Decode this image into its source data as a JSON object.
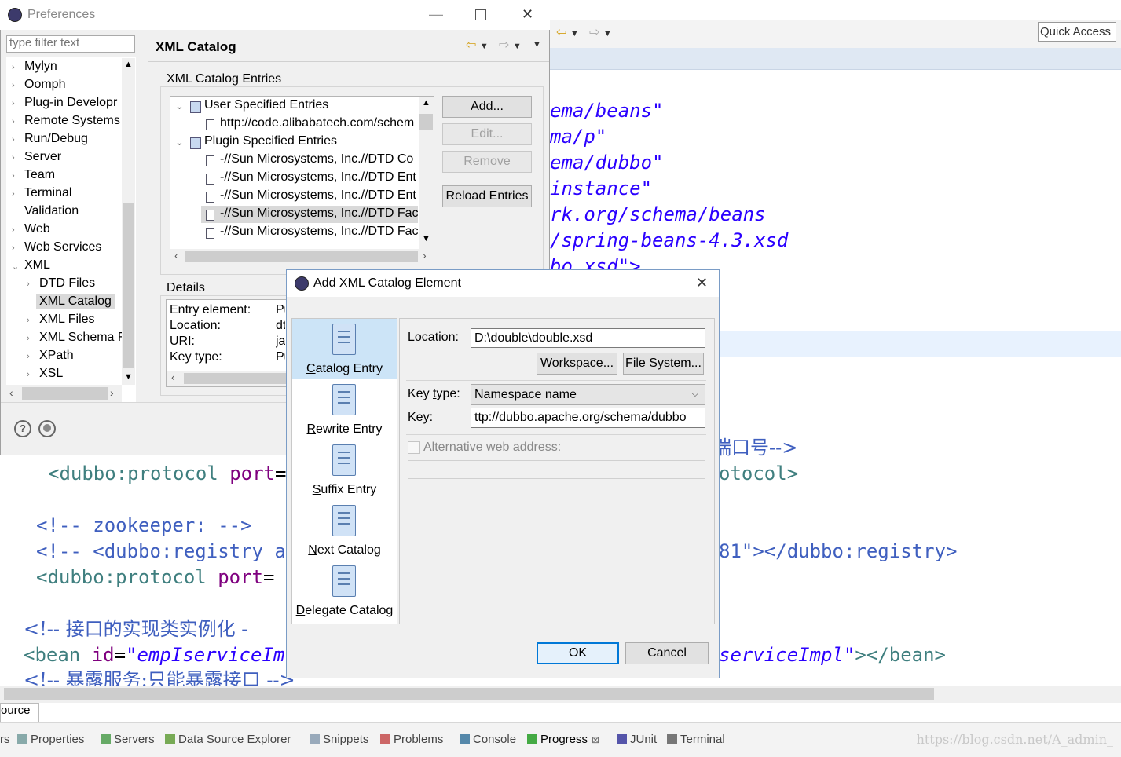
{
  "editor": {
    "quick_access": "Quick Access",
    "lines": [
      {
        "parts": [
          {
            "t": "ema/beans\"",
            "c": "str"
          }
        ]
      },
      {
        "parts": [
          {
            "t": "ma/p\"",
            "c": "str"
          }
        ]
      },
      {
        "parts": [
          {
            "t": "ema/dubbo\"",
            "c": "str"
          }
        ]
      },
      {
        "parts": [
          {
            "t": "instance\"",
            "c": "str"
          }
        ]
      },
      {
        "parts": [
          {
            "t": "rk.org/schema/beans",
            "c": "str"
          }
        ]
      },
      {
        "parts": [
          {
            "t": "/spring-beans-4.3.xsd",
            "c": "str"
          }
        ]
      },
      {
        "parts": [
          {
            "t": "bo.xsd\">",
            "c": "str"
          }
        ]
      }
    ],
    "port_comment_tail": "端口号-->",
    "protocol1_left": "<dubbo:protocol port=",
    "protocol1_right": "otocol>",
    "zk_comment": "<!-- zookeeper: -->",
    "registry_left": "<!-- <dubbo:registry a",
    "registry_right": "81\"></dubbo:registry>",
    "protocol2_left": "<dubbo:protocol port=",
    "impl_comment": "<!-- 接口的实现类实例化 -",
    "bean_left_tag": "<bean ",
    "bean_left_attr": "id",
    "bean_left_eq": "=",
    "bean_left_val": "\"empIserviceIm",
    "bean_right_val": "serviceImpl\"",
    "bean_right_tag": "></bean>",
    "expose_comment": "<!-- 暴露服务:只能暴露接口 -->"
  },
  "bottom": {
    "source_tab": "ource",
    "tabs": [
      {
        "label": "rs",
        "icon": "none"
      },
      {
        "label": "Properties",
        "icon": "properties-icon"
      },
      {
        "label": "Servers",
        "icon": "servers-icon"
      },
      {
        "label": "Data Source Explorer",
        "icon": "datasource-icon"
      },
      {
        "label": "Snippets",
        "icon": "snippets-icon"
      },
      {
        "label": "Problems",
        "icon": "problems-icon"
      },
      {
        "label": "Console",
        "icon": "console-icon"
      },
      {
        "label": "Progress",
        "icon": "progress-icon"
      },
      {
        "label": "JUnit",
        "icon": "junit-icon"
      },
      {
        "label": "Terminal",
        "icon": "terminal-icon"
      }
    ],
    "watermark": "https://blog.csdn.net/A_admin_"
  },
  "preferences": {
    "title": "Preferences",
    "filter_placeholder": "type filter text",
    "tree": [
      {
        "label": "Mylyn",
        "expander": "›",
        "level": 0
      },
      {
        "label": "Oomph",
        "expander": "›",
        "level": 0
      },
      {
        "label": "Plug-in Developr",
        "expander": "›",
        "level": 0
      },
      {
        "label": "Remote Systems",
        "expander": "›",
        "level": 0
      },
      {
        "label": "Run/Debug",
        "expander": "›",
        "level": 0
      },
      {
        "label": "Server",
        "expander": "›",
        "level": 0
      },
      {
        "label": "Team",
        "expander": "›",
        "level": 0
      },
      {
        "label": "Terminal",
        "expander": "›",
        "level": 0
      },
      {
        "label": "Validation",
        "expander": "",
        "level": 0
      },
      {
        "label": "Web",
        "expander": "›",
        "level": 0
      },
      {
        "label": "Web Services",
        "expander": "›",
        "level": 0
      },
      {
        "label": "XML",
        "expander": "⌄",
        "level": 0
      },
      {
        "label": "DTD Files",
        "expander": "›",
        "level": 1
      },
      {
        "label": "XML Catalog",
        "expander": "",
        "level": 1,
        "selected": true
      },
      {
        "label": "XML Files",
        "expander": "›",
        "level": 1
      },
      {
        "label": "XML Schema F",
        "expander": "›",
        "level": 1
      },
      {
        "label": "XPath",
        "expander": "›",
        "level": 1
      },
      {
        "label": "XSL",
        "expander": "›",
        "level": 1
      }
    ],
    "page_title": "XML Catalog",
    "entries_group": "XML Catalog Entries",
    "entries": [
      {
        "label": "User Specified Entries",
        "kind": "catalog",
        "level": 0,
        "expander": "⌄"
      },
      {
        "label": "http://code.alibabatech.com/schem",
        "kind": "doc",
        "level": 1
      },
      {
        "label": "Plugin Specified Entries",
        "kind": "catalog",
        "level": 0,
        "expander": "⌄"
      },
      {
        "label": "-//Sun Microsystems, Inc.//DTD Co",
        "kind": "doc",
        "level": 1
      },
      {
        "label": "-//Sun Microsystems, Inc.//DTD Ent",
        "kind": "doc",
        "level": 1
      },
      {
        "label": "-//Sun Microsystems, Inc.//DTD Ent",
        "kind": "doc",
        "level": 1
      },
      {
        "label": "-//Sun Microsystems, Inc.//DTD Fac",
        "kind": "doc",
        "level": 1,
        "selected": true
      },
      {
        "label": "-//Sun Microsystems, Inc.//DTD Fac",
        "kind": "doc",
        "level": 1
      }
    ],
    "buttons": {
      "add": "Add...",
      "edit": "Edit...",
      "remove": "Remove",
      "reload": "Reload Entries"
    },
    "details_group": "Details",
    "details": [
      {
        "key": "Entry element:",
        "val": "Pu"
      },
      {
        "key": "Location:",
        "val": "dt"
      },
      {
        "key": "URI:",
        "val": "ja"
      },
      {
        "key": "Key type:",
        "val": "Pu"
      }
    ]
  },
  "dialog": {
    "title": "Add XML Catalog Element",
    "entry_types": [
      {
        "label": "Catalog Entry",
        "mnemonic": "C",
        "rest": "atalog Entry",
        "icon": "catalog-entry-icon",
        "selected": true
      },
      {
        "label": "Rewrite Entry",
        "mnemonic": "R",
        "rest": "ewrite Entry",
        "icon": "rewrite-entry-icon"
      },
      {
        "label": "Suffix Entry",
        "mnemonic": "S",
        "rest": "uffix Entry",
        "icon": "suffix-entry-icon"
      },
      {
        "label": "Next Catalog",
        "mnemonic": "N",
        "rest": "ext Catalog",
        "icon": "next-catalog-icon"
      },
      {
        "label": "Delegate Catalog",
        "mnemonic": "D",
        "rest": "elegate Catalog",
        "icon": "delegate-catalog-icon"
      }
    ],
    "location_label": "Location:",
    "location_mn": "L",
    "location_rest": "ocation:",
    "location_value": "D:\\double\\double.xsd",
    "workspace_btn": "Workspace...",
    "workspace_mn": "W",
    "workspace_rest": "orkspace...",
    "filesystem_btn": "File System...",
    "filesystem_mn": "F",
    "filesystem_rest": "ile System...",
    "keytype_label": "Key type:",
    "keytype_pre": "Key ",
    "keytype_mn": "t",
    "keytype_rest": "ype:",
    "keytype_value": "Namespace name",
    "key_label": "Key:",
    "key_mn": "K",
    "key_rest": "ey:",
    "key_value": "ttp://dubbo.apache.org/schema/dubbo",
    "alt_label": "Alternative web address:",
    "alt_mn": "A",
    "alt_rest": "lternative web address:",
    "ok": "OK",
    "cancel": "Cancel"
  }
}
